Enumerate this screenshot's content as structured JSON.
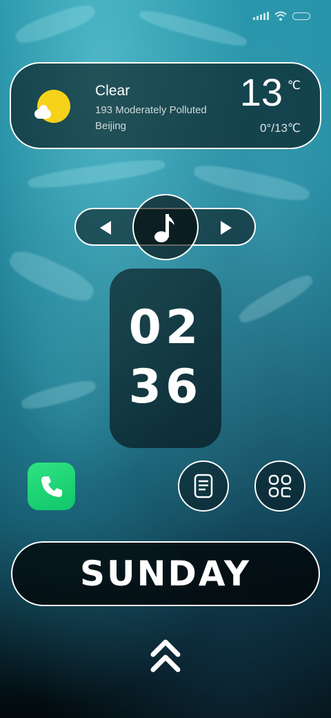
{
  "weather": {
    "condition": "Clear",
    "aqi": "193  Moderately Polluted",
    "city": "Beijing",
    "temperature": "13",
    "unit": "℃",
    "range": "0°/13℃",
    "icon": "sunny-cloud-icon",
    "sun_color": "#f6d21b"
  },
  "music": {
    "prev_icon": "previous-icon",
    "center_icon": "music-note-icon",
    "next_icon": "next-icon"
  },
  "clock": {
    "hour": "02",
    "minute": "36"
  },
  "apps": [
    {
      "name": "Phone",
      "icon": "phone-icon",
      "color": "#1fd472"
    },
    {
      "name": "Notes",
      "icon": "notes-icon"
    },
    {
      "name": "Apps",
      "icon": "apps-grid-icon"
    }
  ],
  "day": "SUNDAY",
  "swipe_icon": "double-chevron-up-icon"
}
